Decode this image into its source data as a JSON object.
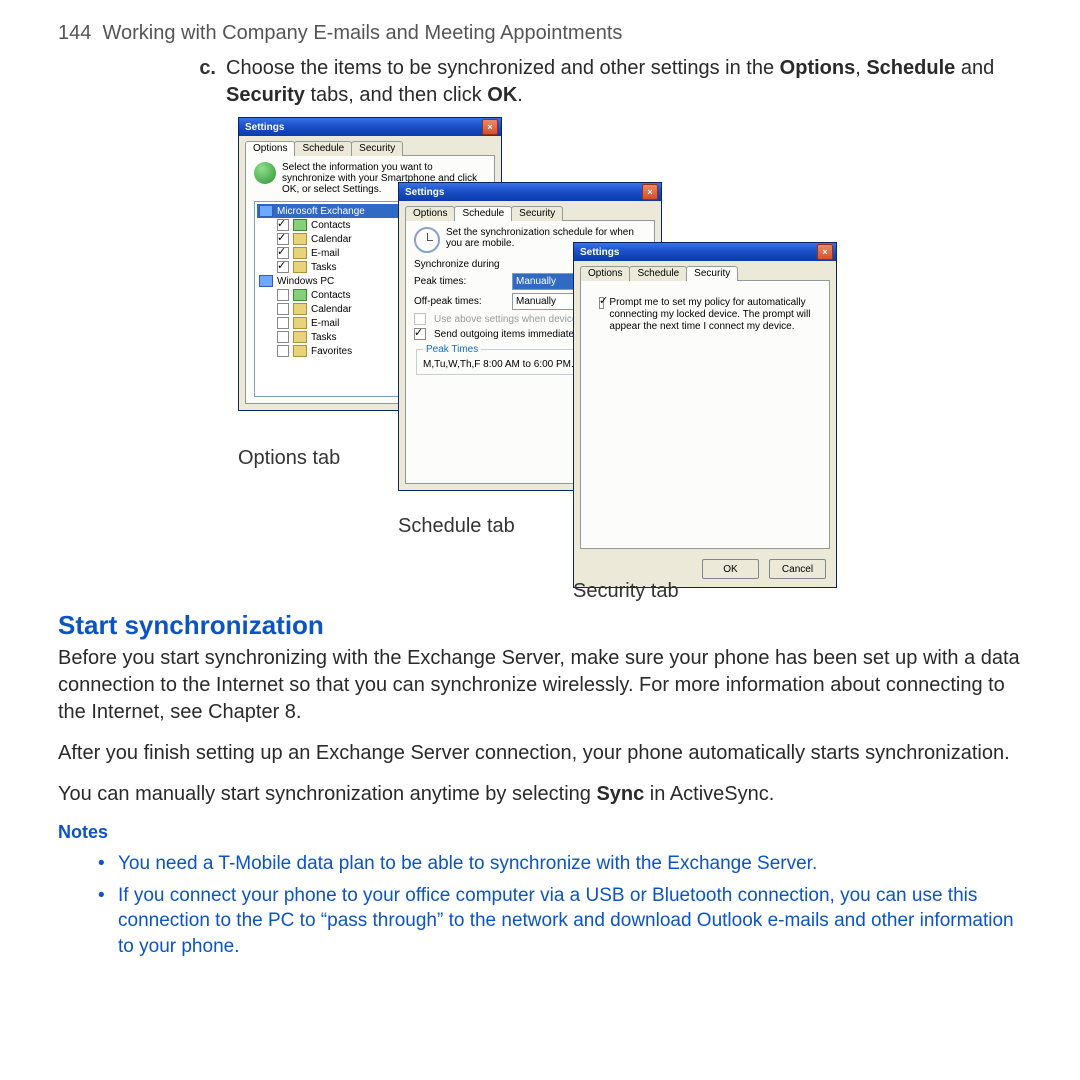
{
  "header": {
    "page_number": "144",
    "title": "Working with Company E-mails and Meeting Appointments"
  },
  "step": {
    "marker": "c.",
    "pre": "Choose the items to be synchronized and other settings in the ",
    "b1": "Options",
    "mid1": ", ",
    "b2": "Schedule",
    "mid2": " and ",
    "b3": "Security",
    "post": " tabs, and then click ",
    "b4": "OK",
    "end": "."
  },
  "common": {
    "window_title": "Settings",
    "tab_options": "Options",
    "tab_schedule": "Schedule",
    "tab_security": "Security"
  },
  "win_options": {
    "info": "Select the information you want to synchronize with your Smartphone and click OK, or select Settings.",
    "tree": {
      "root1": "Microsoft Exchange",
      "root1_items": [
        {
          "name": "Contacts",
          "checked": true
        },
        {
          "name": "Calendar",
          "checked": true
        },
        {
          "name": "E-mail",
          "checked": true
        },
        {
          "name": "Tasks",
          "checked": true
        }
      ],
      "root2": "Windows PC",
      "root2_items": [
        {
          "name": "Contacts",
          "checked": false
        },
        {
          "name": "Calendar",
          "checked": false
        },
        {
          "name": "E-mail",
          "checked": false
        },
        {
          "name": "Tasks",
          "checked": false
        },
        {
          "name": "Favorites",
          "checked": false
        }
      ]
    },
    "caption": "Options tab"
  },
  "win_schedule": {
    "info": "Set the synchronization schedule for when you are mobile.",
    "during_label": "Synchronize during",
    "peak_label": "Peak times:",
    "peak_value": "Manually",
    "offpeak_label": "Off-peak times:",
    "offpeak_value": "Manually",
    "roam_label": "Use above settings when device is roaming",
    "send_immediately": "Send outgoing items immediately",
    "peak_group": "Peak Times",
    "peak_text": "M,Tu,W,Th,F 8:00 AM to 6:00 PM.",
    "caption": "Schedule tab"
  },
  "win_security": {
    "prompt": "Prompt me to set my policy for automatically connecting my locked device. The prompt will appear the next time I connect my device.",
    "ok": "OK",
    "cancel": "Cancel",
    "caption": "Security tab"
  },
  "section": {
    "title": "Start synchronization",
    "p1": "Before you start synchronizing with the Exchange Server, make sure your phone has been set up with a data connection to the Internet so that you can synchronize wirelessly. For more information about connecting to the Internet, see Chapter 8.",
    "p2": "After you finish setting up an Exchange Server connection, your phone automatically starts synchronization.",
    "p3_pre": "You can manually start synchronization anytime by selecting ",
    "p3_bold": "Sync",
    "p3_post": " in ActiveSync."
  },
  "notes": {
    "label": "Notes",
    "items": [
      "You need a T-Mobile data plan to be able to synchronize with the Exchange Server.",
      "If you connect your phone to your office computer via a USB or Bluetooth connection, you can use this connection to the PC to “pass through” to the network and download Outlook e-mails and other information to your phone."
    ]
  }
}
